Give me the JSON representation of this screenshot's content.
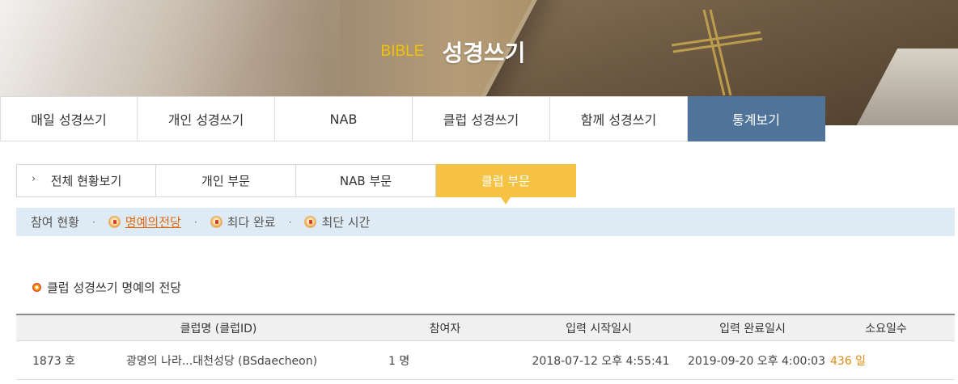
{
  "banner": {
    "title_en": "BIBLE",
    "title_ko": "성경쓰기"
  },
  "main_nav": [
    {
      "label": "매일 성경쓰기",
      "active": false
    },
    {
      "label": "개인 성경쓰기",
      "active": false
    },
    {
      "label": "NAB",
      "active": false
    },
    {
      "label": "클럽 성경쓰기",
      "active": false
    },
    {
      "label": "함께 성경쓰기",
      "active": false
    },
    {
      "label": "통계보기",
      "active": true
    }
  ],
  "sub_tabs": [
    {
      "label": "전체 현황보기",
      "active": false
    },
    {
      "label": "개인 부문",
      "active": false
    },
    {
      "label": "NAB 부문",
      "active": false
    },
    {
      "label": "클럽 부문",
      "active": true
    }
  ],
  "sub_menu": [
    {
      "label": "참여 현황",
      "icon": "",
      "active": false
    },
    {
      "label": "명예의전당",
      "icon": "medal-icon",
      "active": true
    },
    {
      "label": "최다 완료",
      "icon": "medal-icon",
      "active": false
    },
    {
      "label": "최단 시간",
      "icon": "medal-icon",
      "active": false
    }
  ],
  "section": {
    "title": "클럽 성경쓰기 명예의 전당"
  },
  "table": {
    "headers": [
      "클럽명 (클럽ID)",
      "참여자",
      "입력 시작일시",
      "입력 완료일시",
      "소요일수"
    ],
    "rows": [
      {
        "rank": "1873 호",
        "club": "광명의 나라...대천성당 (BSdaecheon)",
        "participants": "1 명",
        "start": "2018-07-12 오후 4:55:41",
        "end": "2019-09-20 오후 4:00:03",
        "days": "436 일"
      }
    ]
  },
  "colors": {
    "active_nav": "#4f7399",
    "active_tab": "#f6c243",
    "submenu_bg": "#deebf5",
    "accent": "#e06a12"
  }
}
